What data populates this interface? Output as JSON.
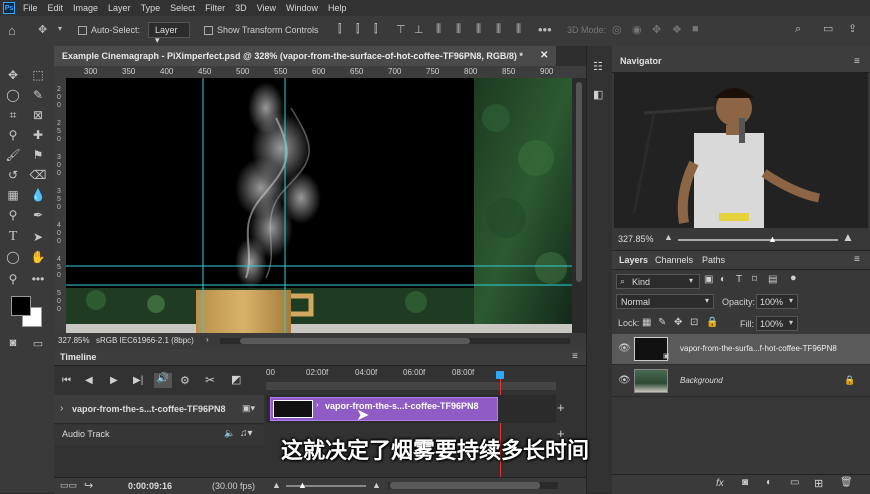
{
  "menu": [
    "File",
    "Edit",
    "Image",
    "Layer",
    "Type",
    "Select",
    "Filter",
    "3D",
    "View",
    "Window",
    "Help"
  ],
  "options": {
    "auto_select_label": "Auto-Select:",
    "layer_dropdown": "Layer",
    "show_transform_label": "Show Transform Controls",
    "mode_3d_label": "3D Mode:"
  },
  "document": {
    "tab_title": "Example Cinemagraph - PiXimperfect.psd @ 328% (vapor-from-the-surface-of-hot-coffee-TF96PN8, RGB/8) *",
    "ruler_marks": [
      "300",
      "350",
      "400",
      "450",
      "500",
      "550",
      "600",
      "650",
      "700",
      "750",
      "800",
      "850",
      "900"
    ],
    "ruler_left_marks": [
      "2\n0\n0",
      "2\n5\n0",
      "3\n0\n0",
      "3\n5\n0",
      "4\n0\n0",
      "4\n5\n0",
      "5\n0\n0"
    ],
    "zoom": "327.85%",
    "color_profile": "sRGB IEC61966-2.1 (8bpc)"
  },
  "timeline": {
    "title": "Timeline",
    "time_marks": [
      "00",
      "02:00f",
      "04:00f",
      "06:00f",
      "08:00f"
    ],
    "clip_track_label": "vapor-from-the-s...t-coffee-TF96PN8",
    "clip_label": "vapor-from-the-s...t-coffee-TF96PN8",
    "audio_track_label": "Audio Track",
    "current_time": "0:00:09:16",
    "fps": "(30.00 fps)"
  },
  "navigator": {
    "title": "Navigator",
    "zoom": "327.85%"
  },
  "layers_panel": {
    "tabs": [
      "Layers",
      "Channels",
      "Paths"
    ],
    "kind_label": "Kind",
    "blend_mode": "Normal",
    "opacity_label": "Opacity:",
    "opacity_value": "100%",
    "lock_label": "Lock:",
    "fill_label": "Fill:",
    "fill_value": "100%",
    "layers": [
      {
        "name": "vapor-from-the-surfa...f-hot-coffee-TF96PN8"
      },
      {
        "name": "Background"
      }
    ]
  },
  "subtitle": "这就决定了烟雾要持续多长时间",
  "colors": {
    "accent_blue": "#31a8ff",
    "clip_purple": "#8f5bc4",
    "guide_cyan": "#2fd0d8"
  }
}
